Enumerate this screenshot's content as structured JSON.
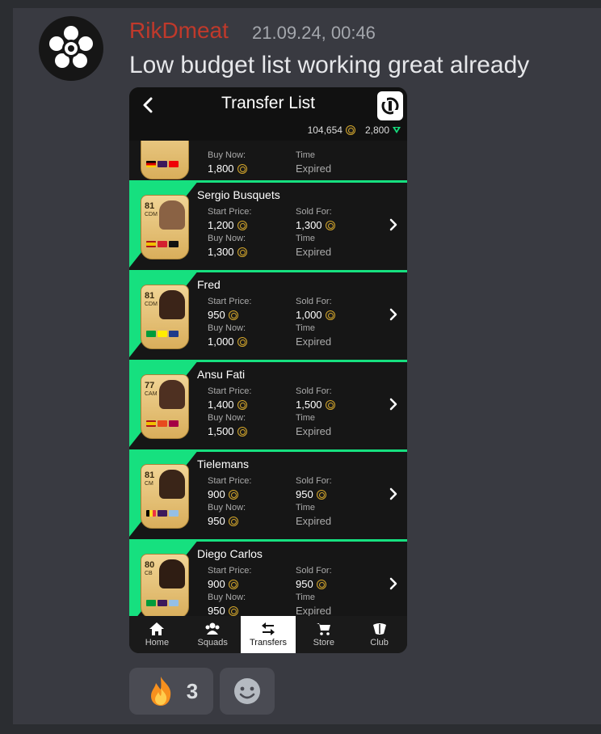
{
  "message": {
    "username": "RikDmeat",
    "timestamp": "21.09.24, 00:46",
    "text": "Low budget list working great already"
  },
  "screenshot": {
    "header": {
      "title": "Transfer List",
      "coins": "104,654",
      "points": "2,800"
    },
    "partial_row": {
      "buy_label": "Buy Now:",
      "buy_value": "1,800",
      "time_label": "Time",
      "time_value": "Expired"
    },
    "rows": [
      {
        "name": "Sergio Busquets",
        "rating": "81",
        "position": "CDM",
        "start_label": "Start Price:",
        "start": "1,200",
        "sold_label": "Sold For:",
        "sold": "1,300",
        "buy_label": "Buy Now:",
        "buy": "1,300",
        "time_label": "Time",
        "time": "Expired"
      },
      {
        "name": "Fred",
        "rating": "81",
        "position": "CDM",
        "start_label": "Start Price:",
        "start": "950",
        "sold_label": "Sold For:",
        "sold": "1,000",
        "buy_label": "Buy Now:",
        "buy": "1,000",
        "time_label": "Time",
        "time": "Expired"
      },
      {
        "name": "Ansu Fati",
        "rating": "77",
        "position": "CAM",
        "start_label": "Start Price:",
        "start": "1,400",
        "sold_label": "Sold For:",
        "sold": "1,500",
        "buy_label": "Buy Now:",
        "buy": "1,500",
        "time_label": "Time",
        "time": "Expired"
      },
      {
        "name": "Tielemans",
        "rating": "81",
        "position": "CM",
        "start_label": "Start Price:",
        "start": "900",
        "sold_label": "Sold For:",
        "sold": "950",
        "buy_label": "Buy Now:",
        "buy": "950",
        "time_label": "Time",
        "time": "Expired"
      },
      {
        "name": "Diego Carlos",
        "rating": "80",
        "position": "CB",
        "start_label": "Start Price:",
        "start": "900",
        "sold_label": "Sold For:",
        "sold": "950",
        "buy_label": "Buy Now:",
        "buy": "950",
        "time_label": "Time",
        "time": "Expired"
      }
    ],
    "nav": [
      {
        "label": "Home",
        "icon": "home-icon"
      },
      {
        "label": "Squads",
        "icon": "people-icon"
      },
      {
        "label": "Transfers",
        "icon": "transfer-arrows-icon"
      },
      {
        "label": "Store",
        "icon": "cart-icon"
      },
      {
        "label": "Club",
        "icon": "club-icon"
      }
    ]
  },
  "reactions": {
    "fire_count": "3"
  },
  "colors": {
    "accent_green": "#16e07f",
    "username_red": "#c0392b",
    "coin_gold": "#d4a62a"
  }
}
